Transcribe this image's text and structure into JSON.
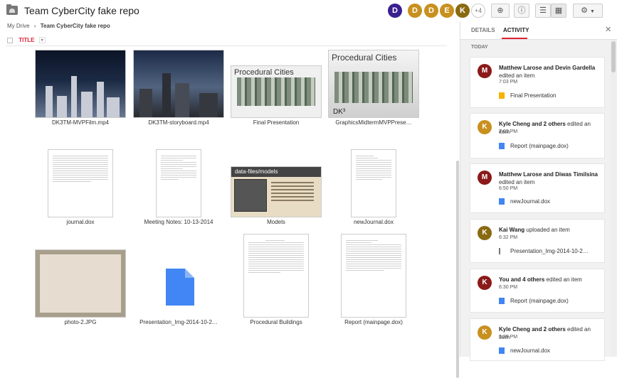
{
  "header": {
    "title": "Team CyberCity fake repo",
    "avatars": [
      {
        "letter": "D",
        "color": "#3a1f8f"
      },
      {
        "letter": "D",
        "color": "#c8901e"
      },
      {
        "letter": "D",
        "color": "#c8901e"
      },
      {
        "letter": "E",
        "color": "#c8901e"
      },
      {
        "letter": "K",
        "color": "#8a6a10"
      }
    ],
    "more_count": "+4"
  },
  "breadcrumb": {
    "root": "My Drive",
    "sep": "›",
    "current": "Team CyberCity fake repo"
  },
  "sort": {
    "label": "TITLE"
  },
  "files": [
    {
      "name": "DK3TM-MVPFilm.mp4",
      "kind": "video-dark"
    },
    {
      "name": "DK3TM-storyboard.mp4",
      "kind": "video-dark"
    },
    {
      "name": "Final Presentation",
      "kind": "slide",
      "slide_title": "Procedural Cities"
    },
    {
      "name": "GraphicsMidtermMVPPrese…",
      "kind": "slide",
      "slide_title": "Procedural Cities"
    },
    {
      "name": "journal.dox",
      "kind": "doc"
    },
    {
      "name": "Meeting Notes: 10-13-2014",
      "kind": "doc"
    },
    {
      "name": "Models",
      "kind": "slide-models",
      "slide_title": "data-files/models"
    },
    {
      "name": "newJournal.dox",
      "kind": "doc"
    },
    {
      "name": "photo-2.JPG",
      "kind": "photo"
    },
    {
      "name": "Presentation_Img-2014-10-2…",
      "kind": "generic"
    },
    {
      "name": "Procedural Buildings",
      "kind": "doc"
    },
    {
      "name": "Report (mainpage.dox)",
      "kind": "doc"
    }
  ],
  "panel": {
    "tabs": [
      "DETAILS",
      "ACTIVITY"
    ],
    "active_tab": "ACTIVITY",
    "section": "TODAY",
    "activities": [
      {
        "letter": "M",
        "color": "#8b1a1a",
        "actors": "Matthew Larose and Devin Gardella",
        "action": "edited an item",
        "time": "7:03 PM",
        "file": "Final Presentation",
        "file_icon": "slides-icon",
        "file_color": "#f4b400"
      },
      {
        "letter": "K",
        "color": "#c8901e",
        "actors": "Kyle Cheng and 2 others",
        "action": "edited an item",
        "time": "7:03 PM",
        "file": "Report (mainpage.dox)",
        "file_icon": "doc-icon",
        "file_color": "#4285f4"
      },
      {
        "letter": "M",
        "color": "#8b1a1a",
        "actors": "Matthew Larose and Diwas Timilsina",
        "action": "edited an item",
        "time": "6:50 PM",
        "file": "newJournal.dox",
        "file_icon": "doc-icon",
        "file_color": "#4285f4"
      },
      {
        "letter": "K",
        "color": "#8a6a10",
        "actors": "Kai Wang",
        "action": "uploaded an item",
        "time": "6:32 PM",
        "file": "Presentation_Img-2014-10-2…",
        "file_icon": "file-icon",
        "file_color": "#777777"
      },
      {
        "letter": "K",
        "color": "#8b1a1a",
        "actors": "You and 4 others",
        "action": "edited an item",
        "time": "6:30 PM",
        "file": "Report (mainpage.dox)",
        "file_icon": "doc-icon",
        "file_color": "#4285f4"
      },
      {
        "letter": "K",
        "color": "#c8901e",
        "actors": "Kyle Cheng and 2 others",
        "action": "edited an item",
        "time": "6:29 PM",
        "file": "newJournal.dox",
        "file_icon": "doc-icon",
        "file_color": "#4285f4"
      }
    ]
  }
}
